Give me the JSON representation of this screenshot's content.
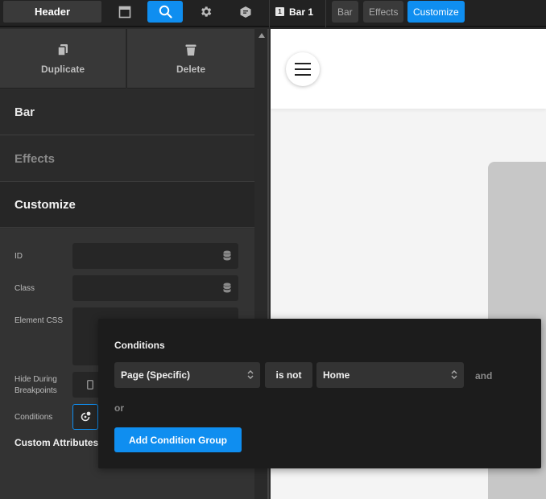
{
  "topbar": {
    "header_label": "Header",
    "icons": [
      "layout-icon",
      "search-icon",
      "gear-icon",
      "page-icon"
    ],
    "breadcrumb": {
      "current_number": "1",
      "current_label": "Bar 1",
      "items": [
        "Bar",
        "Effects",
        "Customize"
      ],
      "active": "Customize"
    }
  },
  "panel": {
    "duplicate_label": "Duplicate",
    "delete_label": "Delete",
    "sections": [
      {
        "label": "Bar"
      },
      {
        "label": "Effects"
      },
      {
        "label": "Customize"
      }
    ],
    "form": {
      "id_label": "ID",
      "id_value": "",
      "class_label": "Class",
      "class_value": "",
      "css_label": "Element CSS",
      "hide_label": "Hide During Breakpoints",
      "conditions_label": "Conditions",
      "custom_attr_label": "Custom Attributes",
      "add_symbol": "+"
    }
  },
  "popup": {
    "title": "Conditions",
    "rule": {
      "field": "Page (Specific)",
      "operator": "is not",
      "value": "Home"
    },
    "and_label": "and",
    "or_label": "or",
    "add_group_label": "Add Condition Group"
  },
  "colors": {
    "accent": "#0f8ef0",
    "panel_bg": "#2f2f2f",
    "popup_bg": "#1c1c1c"
  }
}
